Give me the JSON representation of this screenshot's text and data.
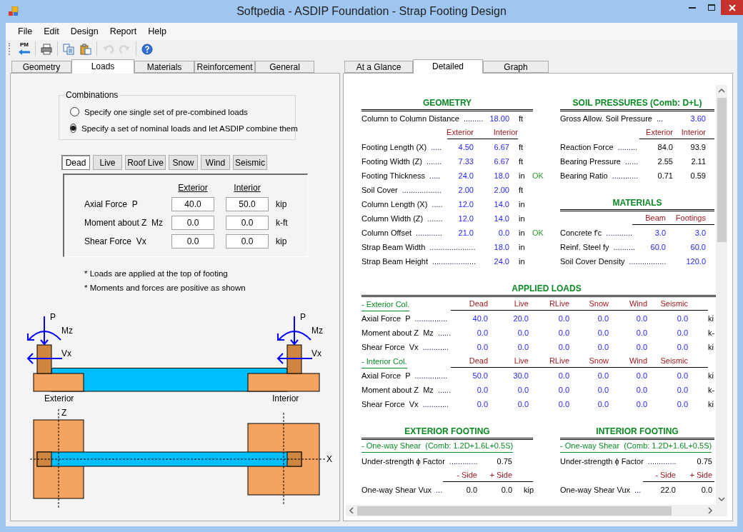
{
  "window": {
    "title": "Softpedia - ASDIP Foundation - Strap Footing Design"
  },
  "menu": [
    "File",
    "Edit",
    "Design",
    "Report",
    "Help"
  ],
  "toolbar": {
    "groups": [
      [
        {
          "kind": "pm",
          "label": "PM",
          "disabled": false
        }
      ],
      [
        {
          "kind": "print",
          "disabled": false
        }
      ],
      [
        {
          "kind": "copy",
          "disabled": false
        },
        {
          "kind": "paste",
          "disabled": false
        }
      ],
      [
        {
          "kind": "undo",
          "disabled": true
        },
        {
          "kind": "redo",
          "disabled": true
        }
      ],
      [
        {
          "kind": "help",
          "disabled": false
        }
      ]
    ]
  },
  "input_tabs": [
    {
      "label": "Geometry",
      "selected": false
    },
    {
      "label": "Loads",
      "selected": true
    },
    {
      "label": "Materials",
      "selected": false
    },
    {
      "label": "Reinforcement",
      "selected": false
    },
    {
      "label": "General",
      "selected": false
    }
  ],
  "combinations": {
    "title": "Combinations",
    "options": [
      {
        "label": "Specify one single set of pre-combined loads",
        "selected": false
      },
      {
        "label": "Specify a set of nominal loads and let ASDIP combine them",
        "selected": true
      }
    ]
  },
  "load_tabs": [
    {
      "label": "Dead",
      "selected": true
    },
    {
      "label": "Live",
      "selected": false
    },
    {
      "label": "Roof Live",
      "selected": false
    },
    {
      "label": "Snow",
      "selected": false
    },
    {
      "label": "Wind",
      "selected": false
    },
    {
      "label": "Seismic",
      "selected": false
    }
  ],
  "load_table": {
    "columns": [
      "Exterior",
      "Interior"
    ],
    "rows": [
      {
        "label": "Axial Force  P",
        "values": [
          "40.0",
          "50.0"
        ],
        "unit": "kip"
      },
      {
        "label": "Moment about Z  Mz",
        "values": [
          "0.0",
          "0.0"
        ],
        "unit": "k-ft"
      },
      {
        "label": "Shear Force  Vx",
        "values": [
          "0.0",
          "0.0"
        ],
        "unit": "kip"
      }
    ]
  },
  "notes": [
    "* Loads are applied at the top of footing",
    "* Moments and forces are positive as shown"
  ],
  "diagram": {
    "columns": [
      {
        "name": "Exterior",
        "labels": [
          "P",
          "Mz",
          "Vx"
        ]
      },
      {
        "name": "Interior",
        "labels": [
          "P",
          "Mz",
          "Vx"
        ]
      }
    ],
    "axes": [
      "Z",
      "X"
    ]
  },
  "report_tabs": [
    {
      "label": "At a Glance",
      "selected": false
    },
    {
      "label": "Detailed",
      "selected": true
    },
    {
      "label": "Graph",
      "selected": false
    }
  ],
  "report": {
    "geometry": {
      "title": "GEOMETRY",
      "rows": [
        {
          "kind": "input",
          "label": "Column to Column Distance",
          "leader": ".........",
          "values": [
            "18.00"
          ],
          "unit": "ft"
        },
        {
          "kind": "header",
          "values": [
            "Exterior",
            "Interior"
          ]
        },
        {
          "kind": "input",
          "label": "Footing Length (X)",
          "leader": ".....",
          "values": [
            "4.50",
            "6.67"
          ],
          "unit": "ft"
        },
        {
          "kind": "input",
          "label": "Footing Width (Z)",
          "leader": ".......",
          "values": [
            "7.33",
            "6.67"
          ],
          "unit": "ft"
        },
        {
          "kind": "input",
          "label": "Footing Thickness",
          "leader": ".....",
          "values": [
            "24.0",
            "18.0"
          ],
          "unit": "in",
          "check": "OK"
        },
        {
          "kind": "input",
          "label": "Soil Cover",
          "leader": "..................",
          "values": [
            "2.00",
            "2.00"
          ],
          "unit": "ft"
        },
        {
          "kind": "input",
          "label": "Column Length (X)",
          "leader": ".....",
          "values": [
            "12.0",
            "14.0"
          ],
          "unit": "in"
        },
        {
          "kind": "input",
          "label": "Column Width (Z)",
          "leader": ".......",
          "values": [
            "12.0",
            "14.0"
          ],
          "unit": "in"
        },
        {
          "kind": "input",
          "label": "Column Offset",
          "leader": "............",
          "values": [
            "21.0",
            "0.0"
          ],
          "unit": "in",
          "check": "OK"
        },
        {
          "kind": "input",
          "label": "Strap Beam Width",
          "leader": ".....................",
          "values": [
            "18.0"
          ],
          "unit": "in"
        },
        {
          "kind": "input",
          "label": "Strap Beam Height",
          "leader": "....................",
          "values": [
            "24.0"
          ],
          "unit": "in"
        }
      ]
    },
    "soil_pressures": {
      "title": "SOIL PRESSURES (Comb: D+L)",
      "rows": [
        {
          "kind": "input",
          "label": "Gross Allow. Soil Pressure",
          "leader": "...",
          "values": [
            "3.60"
          ]
        },
        {
          "kind": "header",
          "values": [
            "Exterior",
            "Interior"
          ]
        },
        {
          "kind": "result",
          "label": "Reaction Force",
          "leader": ".........",
          "values": [
            "84.0",
            "93.9"
          ]
        },
        {
          "kind": "result",
          "label": "Bearing Pressure",
          "leader": "......",
          "values": [
            "2.55",
            "2.11"
          ]
        },
        {
          "kind": "result",
          "label": "Bearing Ratio",
          "leader": "............",
          "values": [
            "0.71",
            "0.59"
          ]
        }
      ]
    },
    "materials": {
      "title": "MATERIALS",
      "rows": [
        {
          "kind": "header",
          "values": [
            "Beam",
            "Footings"
          ]
        },
        {
          "kind": "input",
          "label": "Concrete f'c",
          "leader": "............",
          "values": [
            "3.0",
            "3.0"
          ]
        },
        {
          "kind": "input",
          "label": "Reinf. Steel fy",
          "leader": "..........",
          "values": [
            "60.0",
            "60.0"
          ]
        },
        {
          "kind": "input",
          "label": "Soil Cover Density",
          "leader": ".................",
          "values": [
            "120.0"
          ]
        }
      ]
    },
    "applied_loads": {
      "title": "APPLIED LOADS",
      "groups": [
        {
          "title": "- Exterior Col.",
          "columns": [
            "Dead",
            "Live",
            "RLive",
            "Snow",
            "Wind",
            "Seismic"
          ],
          "rows": [
            {
              "label": "Axial Force  P",
              "leader": "...............",
              "values": [
                "40.0",
                "20.0",
                "0.0",
                "0.0",
                "0.0",
                "0.0"
              ],
              "unit": "ki"
            },
            {
              "label": "Moment about Z  Mz",
              "leader": "......",
              "values": [
                "0.0",
                "0.0",
                "0.0",
                "0.0",
                "0.0",
                "0.0"
              ],
              "unit": "k-"
            },
            {
              "label": "Shear Force  Vx",
              "leader": "............",
              "values": [
                "0.0",
                "0.0",
                "0.0",
                "0.0",
                "0.0",
                "0.0"
              ],
              "unit": "ki"
            }
          ]
        },
        {
          "title": "- Interior Col.",
          "columns": [
            "Dead",
            "Live",
            "RLive",
            "Snow",
            "Wind",
            "Seismic"
          ],
          "rows": [
            {
              "label": "Axial Force  P",
              "leader": "...............",
              "values": [
                "50.0",
                "30.0",
                "0.0",
                "0.0",
                "0.0",
                "0.0"
              ],
              "unit": "ki"
            },
            {
              "label": "Moment about Z  Mz",
              "leader": "......",
              "values": [
                "0.0",
                "0.0",
                "0.0",
                "0.0",
                "0.0",
                "0.0"
              ],
              "unit": "k-"
            },
            {
              "label": "Shear Force  Vx",
              "leader": "............",
              "values": [
                "0.0",
                "0.0",
                "0.0",
                "0.0",
                "0.0",
                "0.0"
              ],
              "unit": "ki"
            }
          ]
        }
      ]
    },
    "exterior_footing": {
      "title": "EXTERIOR FOOTING",
      "subtitle": "- One-way Shear  (Comb: 1.2D+1.6L+0.5S)",
      "rows": [
        {
          "kind": "result",
          "label": "Under-strength ϕ Factor",
          "leader": ".............",
          "values": [
            "0.75"
          ]
        },
        {
          "kind": "header",
          "values": [
            "- Side",
            "+ Side"
          ]
        },
        {
          "kind": "result",
          "label": "One-way Shear Vux",
          "leader": "...",
          "values": [
            "0.0",
            "0.0"
          ],
          "unit": "kip"
        }
      ]
    },
    "interior_footing": {
      "title": "INTERIOR FOOTING",
      "subtitle": "- One-way Shear  (Comb: 1.2D+1.6L+0.5S)",
      "rows": [
        {
          "kind": "result",
          "label": "Under-strength ϕ Factor",
          "leader": ".............",
          "values": [
            "0.75"
          ]
        },
        {
          "kind": "header",
          "values": [
            "- Side",
            "+ Side"
          ]
        },
        {
          "kind": "result",
          "label": "One-way Shear Vux",
          "leader": "...",
          "values": [
            "22.0",
            "0.0"
          ]
        }
      ]
    }
  }
}
